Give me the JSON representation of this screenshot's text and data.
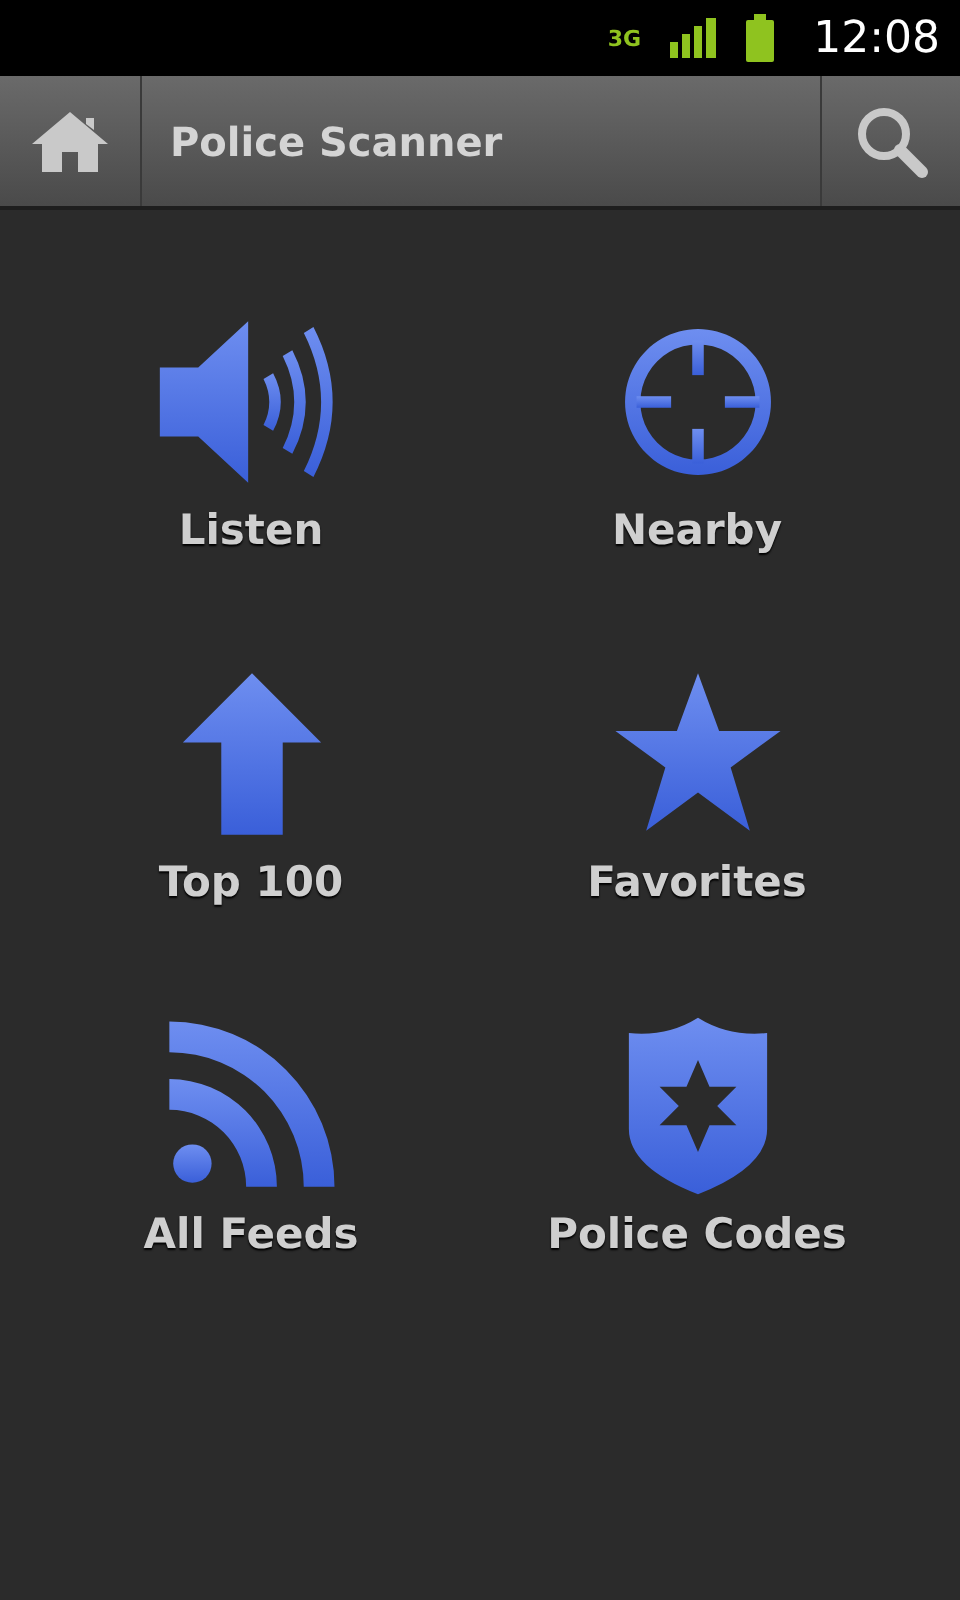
{
  "status_bar": {
    "network": "3G",
    "time": "12:08"
  },
  "action_bar": {
    "title": "Police Scanner"
  },
  "tiles": [
    {
      "kind": "speaker",
      "label": "Listen"
    },
    {
      "kind": "crosshair",
      "label": "Nearby"
    },
    {
      "kind": "arrow",
      "label": "Top 100"
    },
    {
      "kind": "star",
      "label": "Favorites"
    },
    {
      "kind": "feed",
      "label": "All Feeds"
    },
    {
      "kind": "badge",
      "label": "Police Codes"
    }
  ]
}
